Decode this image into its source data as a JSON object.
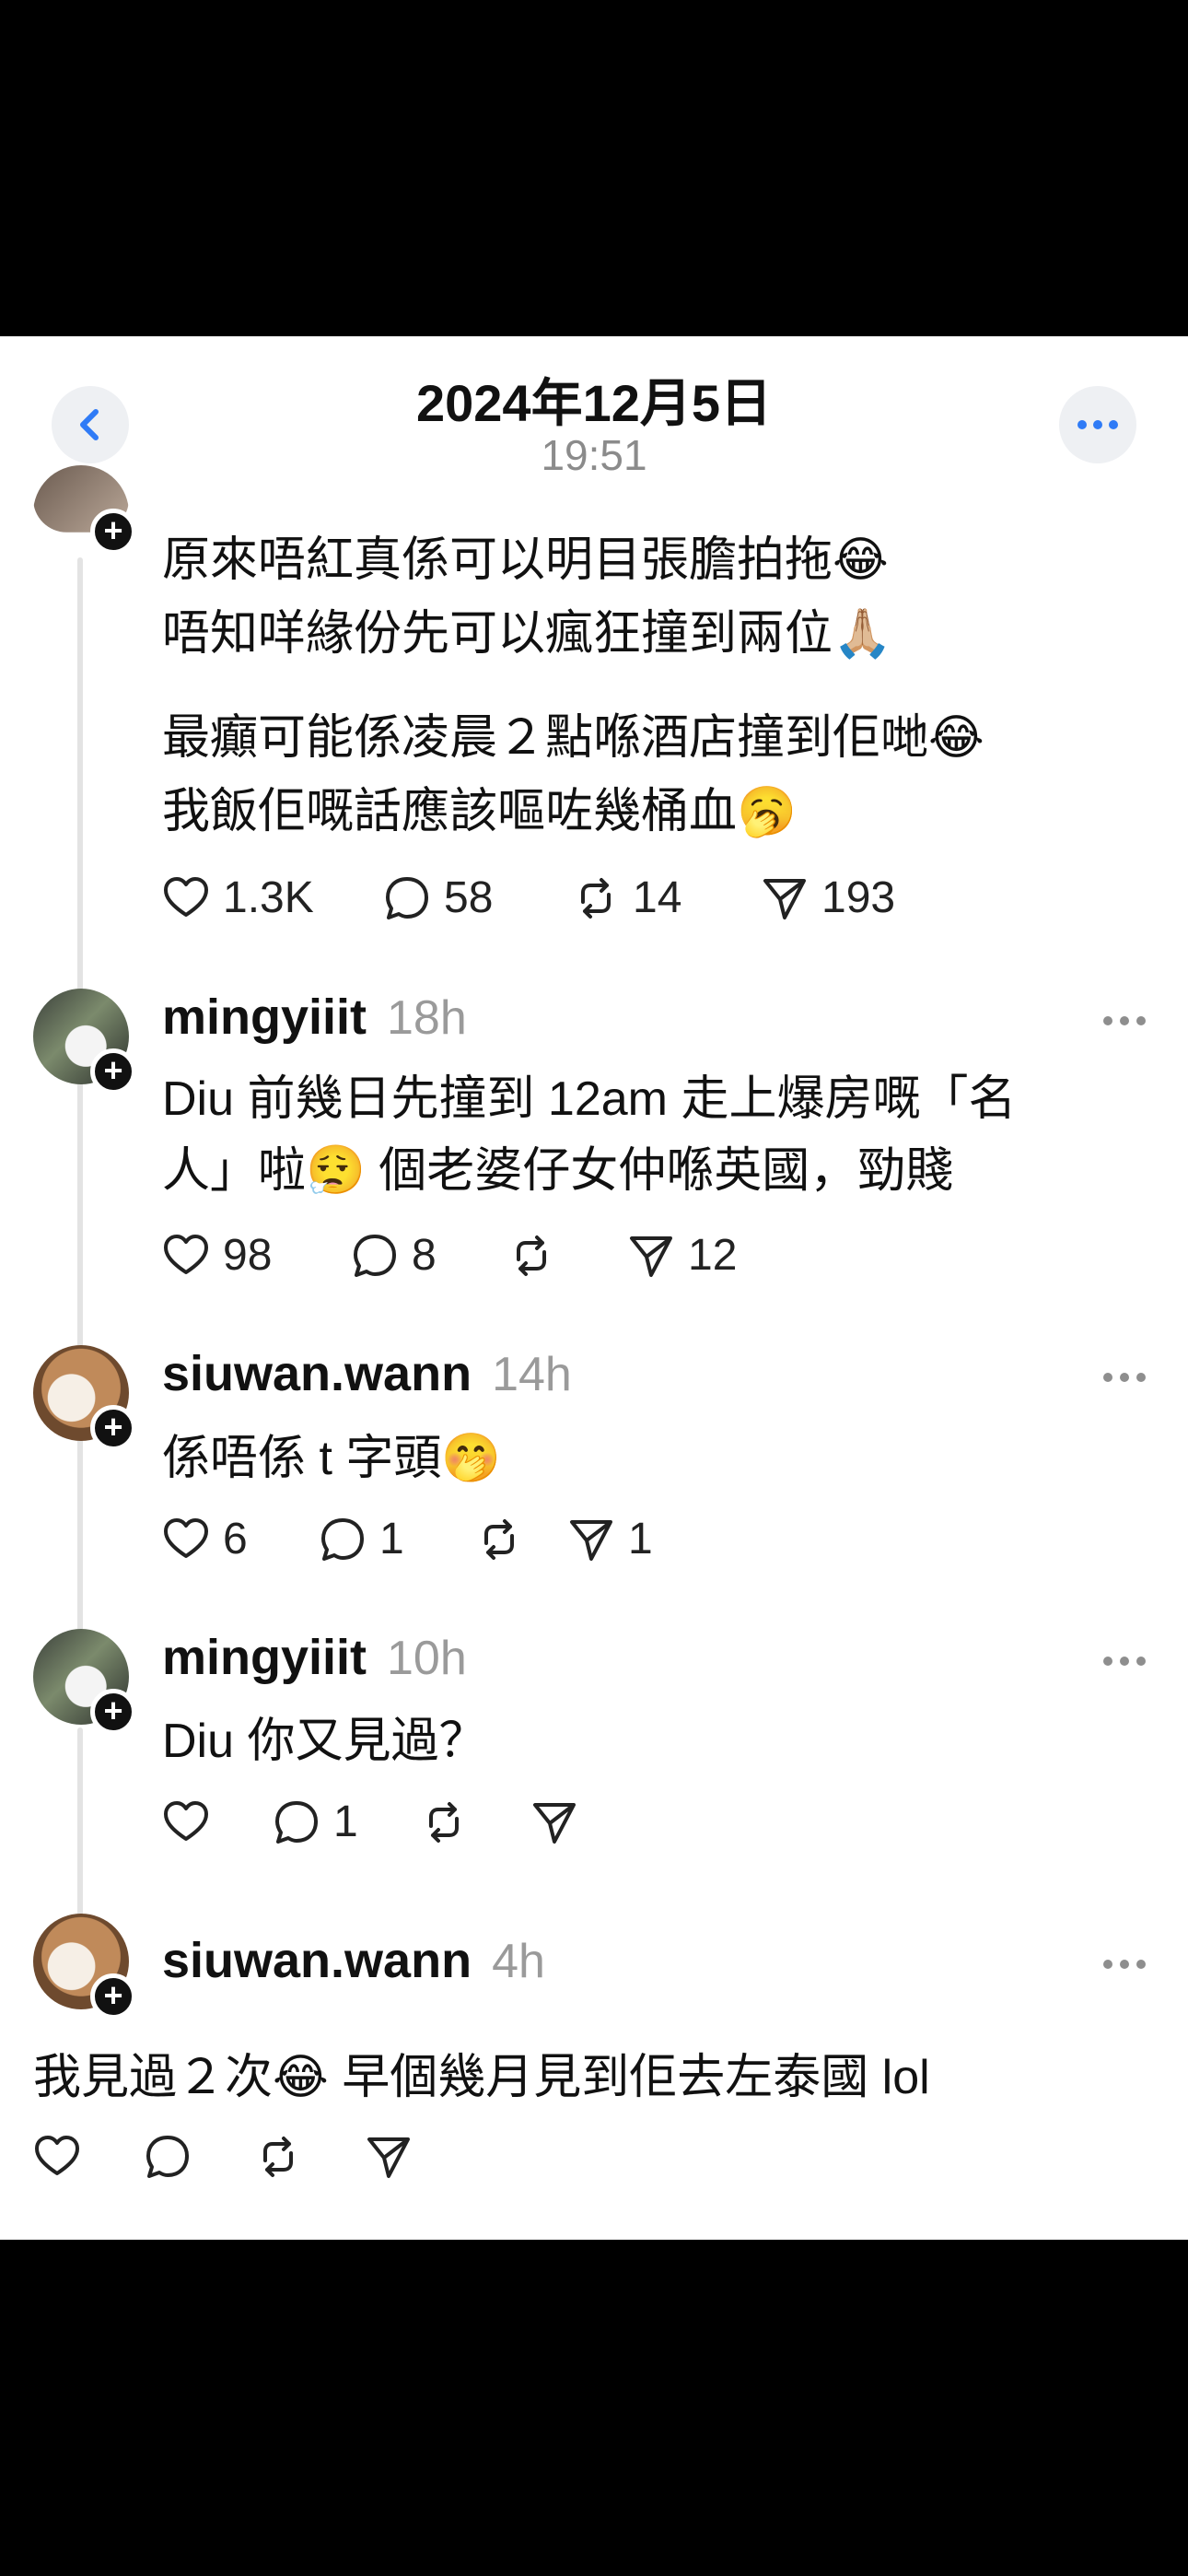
{
  "header": {
    "date": "2024年12月5日",
    "time": "19:51"
  },
  "posts": [
    {
      "lines": [
        "原來唔紅真係可以明目張膽拍拖😂",
        "唔知咩緣份先可以瘋狂撞到兩位🙏🏼",
        "最癲可能係凌晨２點喺酒店撞到佢哋😂",
        "我飯佢嘅話應該嘔咗幾桶血🥱"
      ],
      "likes": "1.3K",
      "replies": "58",
      "reposts": "14",
      "shares": "193"
    },
    {
      "user": "mingyiiit",
      "ago": "18h",
      "lines": [
        "Diu 前幾日先撞到 12am 走上爆房嘅「名",
        "人」啦😮‍💨 個老婆仔女仲喺英國，勁賤"
      ],
      "likes": "98",
      "replies": "8",
      "reposts": "",
      "shares": "12"
    },
    {
      "user": "siuwan.wann",
      "ago": "14h",
      "lines": [
        "係唔係 t 字頭🤭"
      ],
      "likes": "6",
      "replies": "1",
      "reposts": "",
      "shares": "1"
    },
    {
      "user": "mingyiiit",
      "ago": "10h",
      "lines": [
        "Diu 你又見過？"
      ],
      "likes": "",
      "replies": "1",
      "reposts": "",
      "shares": ""
    },
    {
      "user": "siuwan.wann",
      "ago": "4h",
      "lines": [
        "我見過２次😂 早個幾月見到佢去左泰國 lol"
      ],
      "likes": "",
      "replies": "",
      "reposts": "",
      "shares": ""
    }
  ]
}
